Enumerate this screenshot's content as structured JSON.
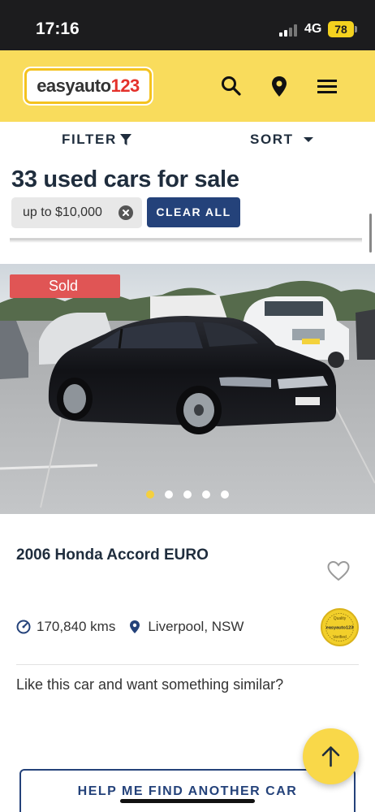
{
  "status_bar": {
    "time": "17:16",
    "network": "4G",
    "battery": "78"
  },
  "header": {
    "logo_part1": "easyauto",
    "logo_part2": "123",
    "icons": [
      "search-icon",
      "location-pin-icon",
      "hamburger-menu-icon"
    ],
    "colors": {
      "background": "#f9dc5c",
      "logo_red": "#e4312b"
    }
  },
  "toolbar": {
    "filter_label": "FILTER",
    "sort_label": "SORT"
  },
  "results": {
    "title": "33 used cars for sale",
    "chip_label": "up to $10,000",
    "clear_all_label": "CLEAR ALL"
  },
  "listing": {
    "badge": "Sold",
    "image_count": 5,
    "active_image": 1,
    "title": "2006 Honda Accord EURO",
    "kms": "170,840 kms",
    "location": "Liverpool, NSW",
    "badge_text_top": "Quality",
    "badge_text_mid": "easyauto123",
    "badge_text_bottom": "Verified",
    "similar_prompt": "Like this car and want something similar?",
    "help_button": "HELP ME FIND ANOTHER CAR"
  },
  "colors": {
    "navy": "#24427a",
    "sold_red": "#e05555",
    "fab_yellow": "#f9d849"
  }
}
